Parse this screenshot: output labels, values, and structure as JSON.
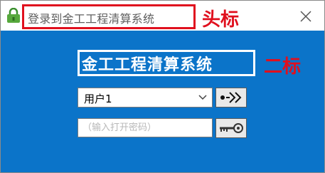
{
  "window": {
    "title": "登录到金工工程清算系统",
    "title_annotation": "头标"
  },
  "main": {
    "heading": "金工工程清算系统",
    "heading_annotation": "二标",
    "user_select": {
      "value": "用户1"
    },
    "password": {
      "placeholder": "（输入打开密码）",
      "value": ""
    }
  },
  "icons": {
    "app": "lock-icon",
    "close": "close-icon",
    "dropdown": "chevron-down-icon",
    "next": "next-arrows-icon",
    "key": "key-icon"
  },
  "colors": {
    "background": "#0b74c9",
    "annotation": "#e0101e",
    "heading_text": "#ffffff"
  }
}
